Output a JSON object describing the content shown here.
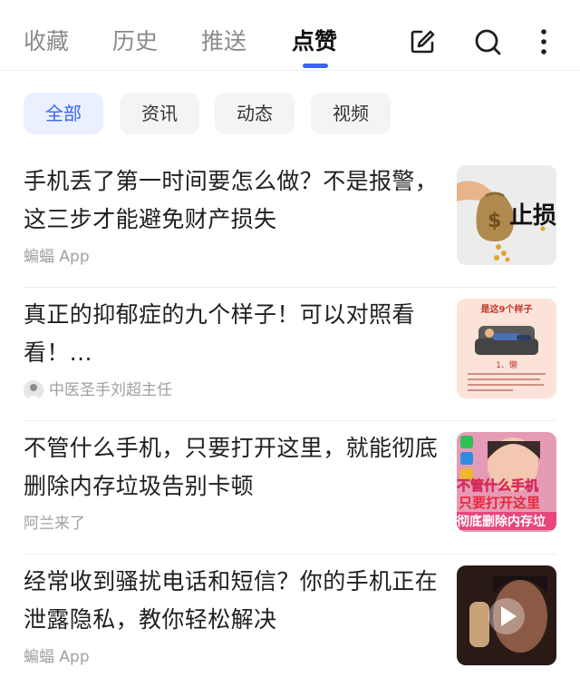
{
  "tabs": [
    {
      "label": "收藏"
    },
    {
      "label": "历史"
    },
    {
      "label": "推送"
    },
    {
      "label": "点赞",
      "active": true
    }
  ],
  "toolbar": {
    "edit_icon": "edit-icon",
    "search_icon": "search-icon",
    "more_icon": "more-vertical-icon"
  },
  "filters": [
    {
      "label": "全部",
      "active": true
    },
    {
      "label": "资讯"
    },
    {
      "label": "动态"
    },
    {
      "label": "视频"
    }
  ],
  "items": [
    {
      "title": "手机丢了第一时间要怎么做？不是报警，这三步才能避免财产损失",
      "source": "蝙蝠 App",
      "thumb_text": "止损"
    },
    {
      "title": "真正的抑郁症的九个样子！可以对照看看！...",
      "source": "中医圣手刘超主任",
      "thumb_heading": "是这9个样子",
      "thumb_caption": "1、懒"
    },
    {
      "title": "不管什么手机，只要打开这里，就能彻底删除内存垃圾告别卡顿",
      "source": "阿兰来了",
      "thumb_lines": [
        "不管什么手机",
        "只要打开这里",
        "彻底删除内存垃"
      ]
    },
    {
      "title": "经常收到骚扰电话和短信？你的手机正在泄露隐私，教你轻松解决",
      "source": "蝙蝠 App"
    }
  ],
  "colors": {
    "accent": "#3a66f0",
    "chip_active_bg": "#eaf0ff",
    "chip_bg": "#f3f4f6",
    "source_text": "#a0a0a0"
  }
}
